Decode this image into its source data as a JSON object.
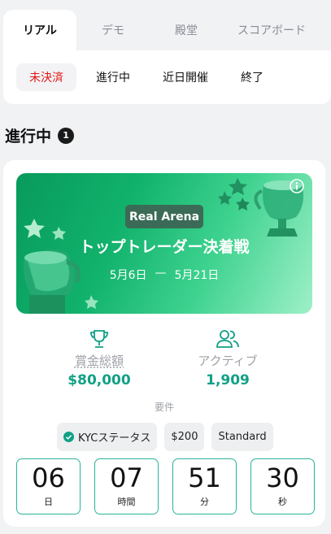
{
  "tabs": [
    {
      "label": "リアル",
      "active": true
    },
    {
      "label": "デモ",
      "active": false
    },
    {
      "label": "殿堂",
      "active": false
    },
    {
      "label": "スコアボード",
      "active": false
    }
  ],
  "filters": [
    {
      "label": "未決済",
      "active": true
    },
    {
      "label": "進行中",
      "active": false
    },
    {
      "label": "近日開催",
      "active": false
    },
    {
      "label": "終了",
      "active": false
    }
  ],
  "section": {
    "title": "進行中",
    "count": "1"
  },
  "contest": {
    "badge": "Real Arena",
    "title": "トップトレーダー決着戦",
    "start_date": "5月6日",
    "date_separator": "—",
    "end_date": "5月21日",
    "prize": {
      "label": "賞金総額",
      "value": "$80,000"
    },
    "active": {
      "label": "アクティブ",
      "value": "1,909"
    },
    "requirements_label": "要件",
    "requirements": [
      "KYCステータス",
      "$200",
      "Standard"
    ],
    "countdown": [
      {
        "value": "06",
        "unit": "日"
      },
      {
        "value": "07",
        "unit": "時間"
      },
      {
        "value": "51",
        "unit": "分"
      },
      {
        "value": "30",
        "unit": "秒"
      }
    ]
  },
  "colors": {
    "accent": "#11a085",
    "filter_active": "#e01515",
    "banner_start": "#089a5c",
    "banner_end": "#9ff0c8"
  },
  "icons": {
    "info": "info-icon",
    "prize": "trophy-icon",
    "active": "users-icon",
    "kyc": "check-circle-icon"
  }
}
